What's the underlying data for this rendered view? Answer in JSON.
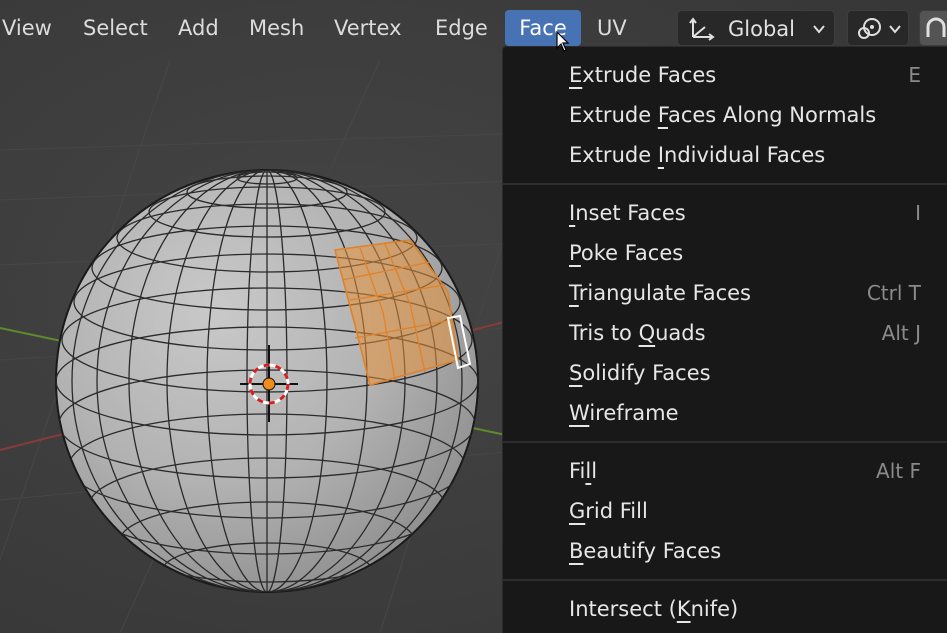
{
  "header": {
    "menus": [
      {
        "label": "View"
      },
      {
        "label": "Select"
      },
      {
        "label": "Add"
      },
      {
        "label": "Mesh"
      },
      {
        "label": "Vertex"
      },
      {
        "label": "Edge"
      },
      {
        "label": "Face"
      },
      {
        "label": "UV"
      }
    ],
    "active_menu": "Face",
    "orientation": {
      "label": "Global",
      "icon": "transform-orientation-icon"
    },
    "pivot": {
      "icon": "pivot-point-icon"
    },
    "snap": {
      "icon": "snap-magnet-icon"
    }
  },
  "face_menu": {
    "groups": [
      [
        {
          "pre": "",
          "ul": "E",
          "post": "xtrude Faces",
          "shortcut": "E"
        },
        {
          "pre": "Extrude ",
          "ul": "F",
          "post": "aces Along Normals",
          "shortcut": ""
        },
        {
          "pre": "Extrude ",
          "ul": "I",
          "post": "ndividual Faces",
          "shortcut": ""
        }
      ],
      [
        {
          "pre": "",
          "ul": "I",
          "post": "nset Faces",
          "shortcut": "I"
        },
        {
          "pre": "",
          "ul": "P",
          "post": "oke Faces",
          "shortcut": ""
        },
        {
          "pre": "",
          "ul": "T",
          "post": "riangulate Faces",
          "shortcut": "Ctrl T"
        },
        {
          "pre": "Tris to ",
          "ul": "Q",
          "post": "uads",
          "shortcut": "Alt J"
        },
        {
          "pre": "",
          "ul": "S",
          "post": "olidify Faces",
          "shortcut": ""
        },
        {
          "pre": "",
          "ul": "W",
          "post": "ireframe",
          "shortcut": ""
        }
      ],
      [
        {
          "pre": "Fi",
          "ul": "l",
          "post": "l",
          "shortcut": "Alt F"
        },
        {
          "pre": "",
          "ul": "G",
          "post": "rid Fill",
          "shortcut": ""
        },
        {
          "pre": "",
          "ul": "B",
          "post": "eautify Faces",
          "shortcut": ""
        }
      ],
      [
        {
          "pre": "Intersect (",
          "ul": "K",
          "post": "nife)",
          "shortcut": ""
        }
      ]
    ]
  },
  "colors": {
    "accent": "#4772b3",
    "menu_bg": "#181818",
    "selection": "#e8913a",
    "viewport_bg": "#3a3a3a"
  }
}
